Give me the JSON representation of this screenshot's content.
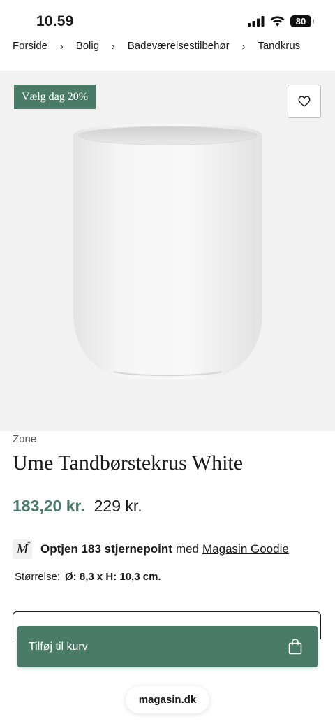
{
  "status_bar": {
    "time": "10.59",
    "battery": "80"
  },
  "breadcrumb": {
    "items": [
      "Forside",
      "Bolig",
      "Badeværelsestilbehør",
      "Tandkrus"
    ],
    "separator": "›"
  },
  "product": {
    "badge": "Vælg dag 20%",
    "brand": "Zone",
    "name": "Ume Tandbørstekrus White",
    "price_sale": "183,20 kr.",
    "price_original": "229 kr.",
    "points": {
      "bold_text": "Optjen 183 stjernepoint",
      "middle_text": "med",
      "link_text": "Magasin Goodie",
      "logo_letter": "M",
      "logo_mark": "*"
    },
    "size_label": "Størrelse:",
    "size_value": "Ø: 8,3 x H: 10,3 cm."
  },
  "actions": {
    "add_to_cart": "Tilføj til kurv"
  },
  "browser": {
    "url": "magasin.dk"
  },
  "icons": {
    "wishlist": "heart-icon",
    "cart": "shopping-bag-icon",
    "signal": "signal-icon",
    "wifi": "wifi-icon",
    "battery": "battery-icon"
  },
  "colors": {
    "accent": "#4a7b69",
    "image_bg": "#f2f2f2"
  }
}
